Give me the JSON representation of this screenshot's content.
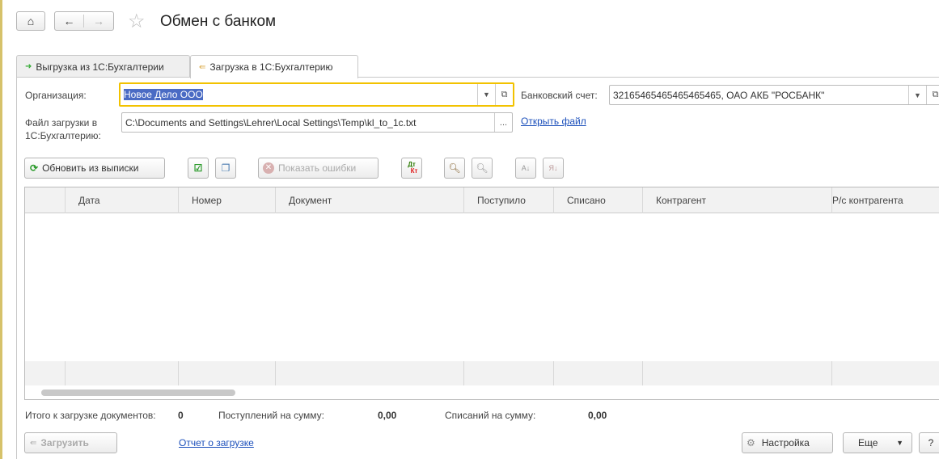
{
  "header": {
    "title": "Обмен с банком"
  },
  "tabs": [
    {
      "label": "Выгрузка из 1С:Бухгалтерии"
    },
    {
      "label": "Загрузка в 1С:Бухгалтерию"
    }
  ],
  "form": {
    "org_label": "Организация:",
    "org_value": "Новое Дело ООО",
    "bank_label": "Банковский счет:",
    "bank_value": "32165465465465465465, ОАО АКБ \"РОСБАНК\"",
    "file_label": "Файл загрузки в 1С:Бухгалтерию:",
    "file_value": "C:\\Documents and Settings\\Lehrer\\Local Settings\\Temp\\kl_to_1c.txt",
    "file_button": "...",
    "open_file": "Открыть файл"
  },
  "toolbar": {
    "refresh": "Обновить из выписки",
    "show_errors": "Показать ошибки",
    "dtkt_dt": "Дт",
    "dtkt_kt": "Кт"
  },
  "table": {
    "columns": [
      "Дата",
      "Номер",
      "Документ",
      "Поступило",
      "Списано",
      "Контрагент",
      "Р/с контрагента"
    ]
  },
  "totals": {
    "docs_label": "Итого к загрузке документов:",
    "docs_value": "0",
    "in_label": "Поступлений на сумму:",
    "in_value": "0,00",
    "out_label": "Списаний на сумму:",
    "out_value": "0,00"
  },
  "footer": {
    "load": "Загрузить",
    "report": "Отчет о загрузке",
    "settings": "Настройка",
    "more": "Еще",
    "help": "?"
  }
}
